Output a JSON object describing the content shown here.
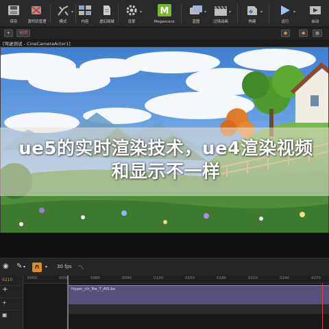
{
  "toolbar": {
    "items": [
      {
        "label": "保存",
        "icon": "save-icon"
      },
      {
        "label": "源代码管理",
        "icon": "source-control-icon"
      },
      {
        "label": "模式",
        "icon": "modes-icon"
      },
      {
        "label": "内容",
        "icon": "content-icon"
      },
      {
        "label": "虚幻商城",
        "icon": "marketplace-icon"
      },
      {
        "label": "设置",
        "icon": "settings-icon"
      },
      {
        "label": "Megascans",
        "icon": "megascans-icon"
      },
      {
        "label": "蓝图",
        "icon": "blueprints-icon"
      },
      {
        "label": "过场动画",
        "icon": "cinematics-icon"
      },
      {
        "label": "构建",
        "icon": "build-icon"
      },
      {
        "label": "运行",
        "icon": "play-icon"
      },
      {
        "label": "启动",
        "icon": "launch-icon"
      }
    ]
  },
  "viewport": {
    "header_buttons": [
      "+",
      "关闭"
    ],
    "right_buttons": [
      "●",
      "●"
    ],
    "tab_title": "[驾驶测试 - CineCameraActor1]"
  },
  "overlay": {
    "title": "ue5的实时渲染技术，ue4渲染视频和显示不一样"
  },
  "sequencer": {
    "fps": "30 fps",
    "timecode": "0210",
    "tick_labels": [
      "0000",
      "0030",
      "0060",
      "0090",
      "0120",
      "0150",
      "0180",
      "0210",
      "0240",
      "0270"
    ],
    "clip_label": "Hyper_ctr_Rw_T_AIS.bo",
    "accent_color": "#e08a1e",
    "clip_color": "#56507a"
  }
}
